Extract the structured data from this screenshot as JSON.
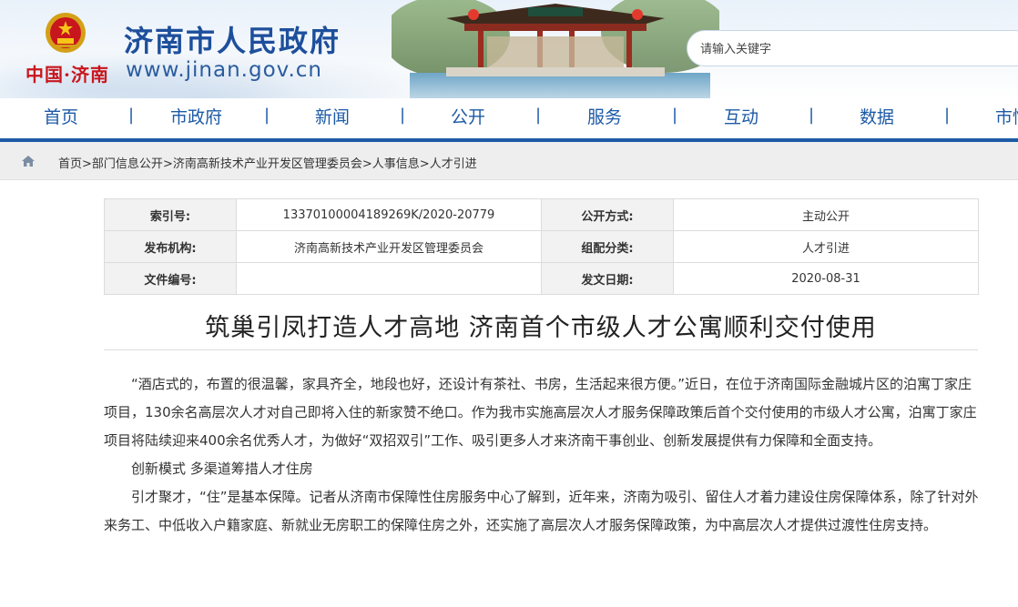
{
  "header": {
    "site_title": "济南市人民政府",
    "site_url": "www.jinan.gov.cn",
    "brand_small": "中国·济南",
    "search_placeholder": "请输入关键字",
    "accent_color": "#1d5aa6"
  },
  "nav": {
    "items": [
      "首页",
      "市政府",
      "新闻",
      "公开",
      "服务",
      "互动",
      "数据",
      "市情"
    ]
  },
  "breadcrumb": {
    "home_icon": "home-icon",
    "items": [
      "首页",
      "部门信息公开",
      "济南高新技术产业开发区管理委员会",
      "人事信息",
      "人才引进"
    ],
    "separator": ">"
  },
  "info": {
    "index_label": "索引号:",
    "index_value": "1337010000418926​9K/2020-20779",
    "mode_label": "公开方式:",
    "mode_value": "主动公开",
    "org_label": "发布机构:",
    "org_value": "济南高新技术产业开发区管理委员会",
    "category_label": "组配分类:",
    "category_value": "人才引进",
    "docno_label": "文件编号:",
    "docno_value": "",
    "date_label": "发文日期:",
    "date_value": "2020-08-31"
  },
  "article": {
    "title": "筑巢引凤打造人才高地 济南首个市级人才公寓顺利交付使用",
    "paragraphs": [
      "“酒店式的，布置的很温馨，家具齐全，地段也好，还设计有茶社、书房，生活起来很方便。”近日，在位于济南国际金融城片区的泊寓丁家庄项目，130余名高层次人才对自己即将入住的新家赞不绝口。作为我市实施高层次人才服务保障政策后首个交付使用的市级人才公寓，泊寓丁家庄项目将陆续迎来400余名优秀人才，为做好“双招双引”工作、吸引更多人才来济南干事创业、创新发展提供有力保障和全面支持。",
      "创新模式 多渠道筹措人才住房",
      "引才聚才，“住”是基本保障。记者从济南市保障性住房服务中心了解到，近年来，济南为吸引、留住人才着力建设住房保障体系，除了针对外来务工、中低收入户籍家庭、新就业无房职工的保障住房之外，还实施了高层次人才服务保障政策，为中高层次人才提供过渡性住房支持。"
    ]
  }
}
